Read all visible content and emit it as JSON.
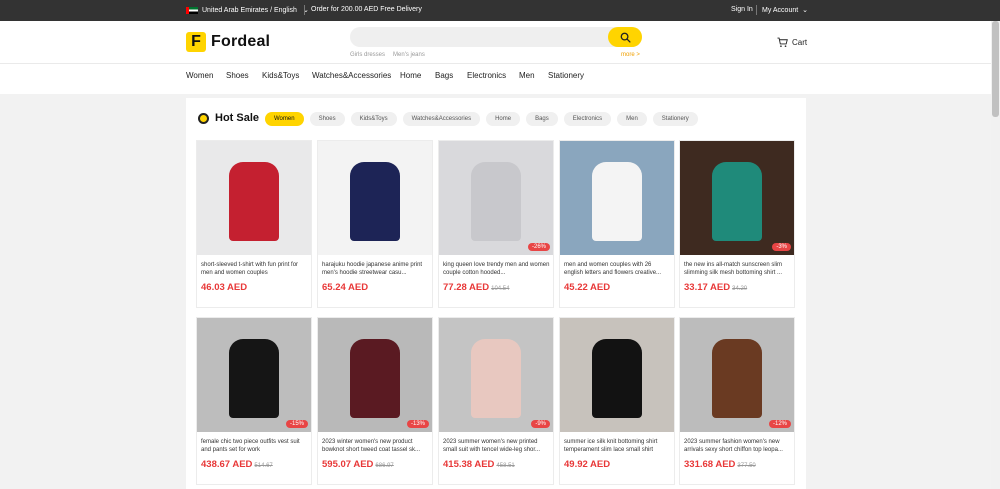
{
  "topbar": {
    "region": "United Arab Emirates / English",
    "promo": "Order for 200.00 AED Free Delivery",
    "sign_in": "Sign In",
    "account": "My Account"
  },
  "header": {
    "logo_letter": "F",
    "logo_text": "Fordeal",
    "search_placeholder": "",
    "hot_words": [
      "Girls dresses",
      "Men's jeans"
    ],
    "more": "more >",
    "cart": "Cart"
  },
  "nav": [
    "Women",
    "Shoes",
    "Kids&Toys",
    "Watches&Accessories",
    "Home",
    "Bags",
    "Electronics",
    "Men",
    "Stationery"
  ],
  "hot_sale": {
    "title": "Hot Sale",
    "chips": [
      "Women",
      "Shoes",
      "Kids&Toys",
      "Watches&Accessories",
      "Home",
      "Bags",
      "Electronics",
      "Men",
      "Stationery"
    ],
    "active_chip": "Women"
  },
  "products": [
    {
      "title": "short-sleeved t-shirt with fun print for men and women couples",
      "price": "46.03 AED",
      "old": "",
      "discount": "",
      "bg": "#e9e9ea",
      "accent": "#c42030"
    },
    {
      "title": "harajuku hoodie japanese anime print men's hoodie streetwear casu...",
      "price": "65.24 AED",
      "old": "",
      "discount": "",
      "bg": "#f3f3f3",
      "accent": "#1d2456"
    },
    {
      "title": "king queen love trendy men and women couple cotton hooded...",
      "price": "77.28 AED",
      "old": "104.54",
      "discount": "-26%",
      "bg": "#d9d9dc",
      "accent": "#c8c8cc"
    },
    {
      "title": "men and women couples with 26 english letters and flowers creative...",
      "price": "45.22 AED",
      "old": "",
      "discount": "",
      "bg": "#8aa6be",
      "accent": "#f4f4f4"
    },
    {
      "title": "the new ins all-match sunscreen slim slimming silk mesh bottoming shirt ...",
      "price": "33.17 AED",
      "old": "34.20",
      "discount": "-3%",
      "bg": "#3e2a20",
      "accent": "#1f8a7a"
    },
    {
      "title": "female chic two piece outfits vest suit and pants set for work",
      "price": "438.67 AED",
      "old": "514.67",
      "discount": "-15%",
      "bg": "#bdbdbd",
      "accent": "#151515"
    },
    {
      "title": "2023 winter women's new product bowknot short tweed coat tassel sk...",
      "price": "595.07 AED",
      "old": "686.97",
      "discount": "-13%",
      "bg": "#b9b9b9",
      "accent": "#5a1a22"
    },
    {
      "title": "2023 summer women's new printed small suit with tencel wide-leg shor...",
      "price": "415.38 AED",
      "old": "458.51",
      "discount": "-9%",
      "bg": "#c4c4c4",
      "accent": "#e8c8c0"
    },
    {
      "title": "summer ice silk knit bottoming shirt temperament slim lace small shirt",
      "price": "49.92 AED",
      "old": "",
      "discount": "",
      "bg": "#c7c2bc",
      "accent": "#121212"
    },
    {
      "title": "2023 summer fashion women's new arrivals sexy short chiffon top leopa...",
      "price": "331.68 AED",
      "old": "377.50",
      "discount": "-12%",
      "bg": "#bcbcbc",
      "accent": "#6a3a22"
    }
  ],
  "colors": {
    "brand": "#ffd400",
    "price": "#e83838",
    "topbar": "#333333"
  },
  "icons": {
    "search": "search-icon",
    "cart": "cart-icon",
    "chevron": "chevron-down-icon",
    "flag": "uae-flag-icon",
    "hot": "hot-sale-icon"
  }
}
